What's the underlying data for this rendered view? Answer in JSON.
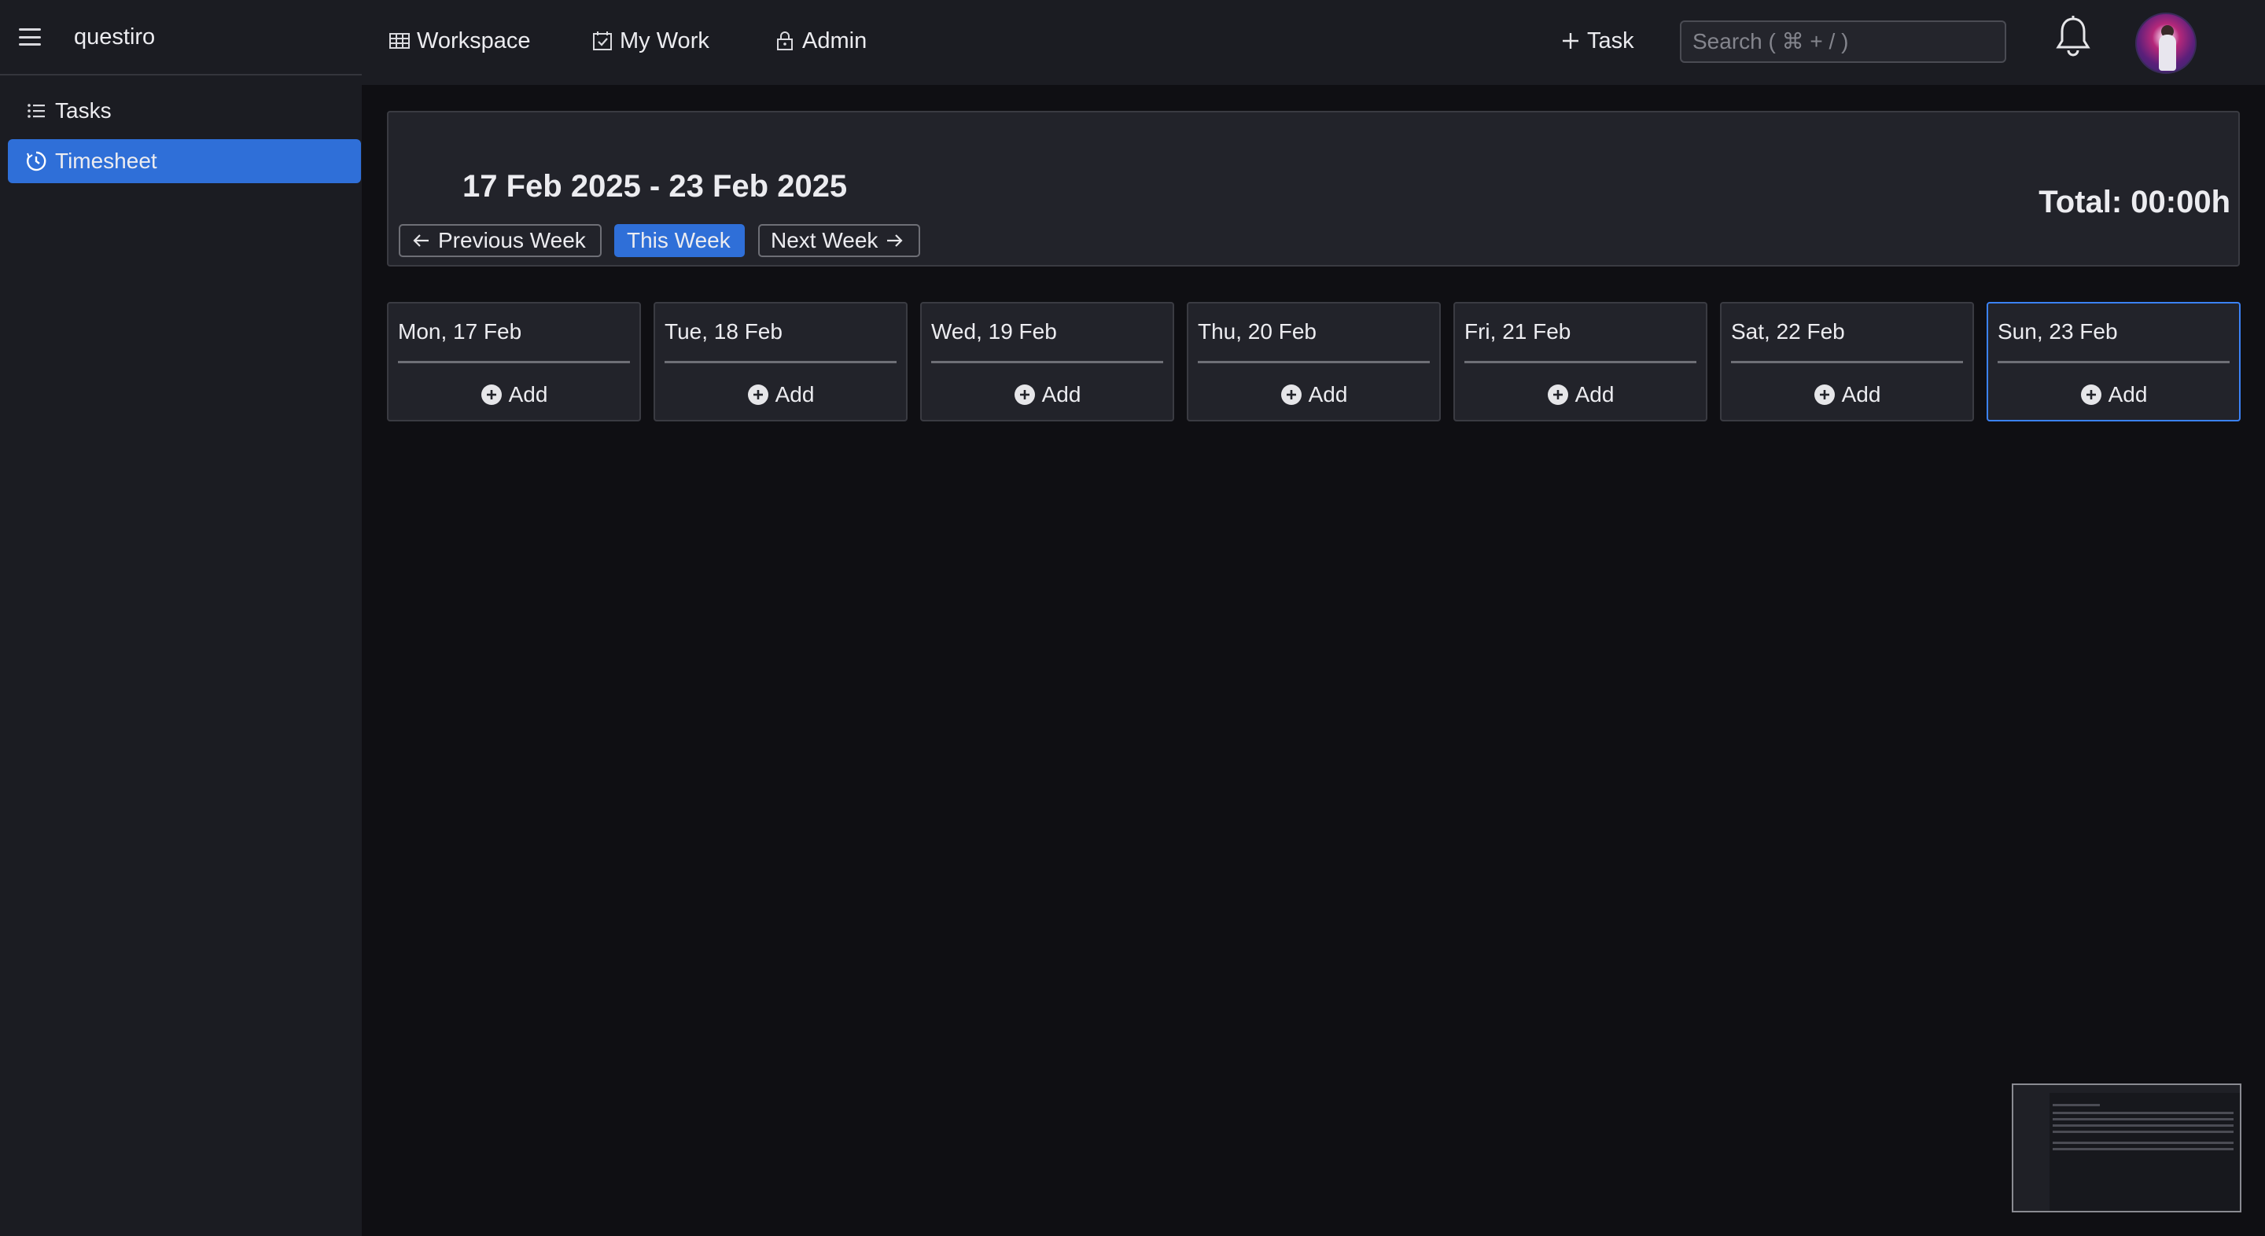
{
  "sidebar": {
    "brand": "questiro",
    "items": [
      {
        "label": "Tasks",
        "icon": "list-icon",
        "active": false
      },
      {
        "label": "Timesheet",
        "icon": "clock-icon",
        "active": true
      }
    ]
  },
  "topnav": {
    "links": [
      {
        "label": "Workspace",
        "icon": "table-icon"
      },
      {
        "label": "My Work",
        "icon": "calendar-check-icon"
      },
      {
        "label": "Admin",
        "icon": "lock-icon"
      }
    ],
    "add_task_label": "Task",
    "search_placeholder": "Search ( ⌘ + / )"
  },
  "timesheet": {
    "range": "17 Feb 2025 - 23 Feb 2025",
    "total": "Total: 00:00h",
    "prev_label": "Previous Week",
    "this_label": "This Week",
    "next_label": "Next Week",
    "days": [
      {
        "label": "Mon, 17 Feb",
        "add": "Add"
      },
      {
        "label": "Tue, 18 Feb",
        "add": "Add"
      },
      {
        "label": "Wed, 19 Feb",
        "add": "Add"
      },
      {
        "label": "Thu, 20 Feb",
        "add": "Add"
      },
      {
        "label": "Fri, 21 Feb",
        "add": "Add"
      },
      {
        "label": "Sat, 22 Feb",
        "add": "Add"
      },
      {
        "label": "Sun, 23 Feb",
        "add": "Add",
        "today": true
      }
    ]
  },
  "colors": {
    "accent": "#2f6fd8",
    "background": "#0f0f13",
    "panel": "#22232a",
    "today_border": "#3b82f6"
  }
}
